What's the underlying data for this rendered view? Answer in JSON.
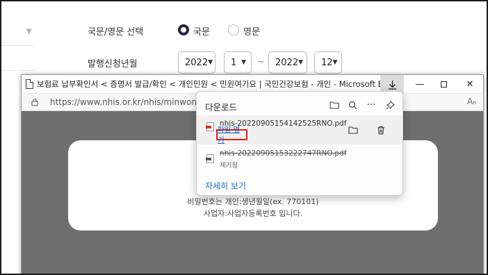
{
  "background": {
    "language_label": "국문/영문 선택",
    "radio_options": [
      {
        "label": "국문",
        "selected": true
      },
      {
        "label": "영문",
        "selected": false
      }
    ],
    "date_label": "발행신청년월",
    "from_year": "2022",
    "from_month": "1",
    "separator": "~",
    "to_year": "2022",
    "to_month": "12"
  },
  "window": {
    "title": "보험료 납부확인서 < 증명서 발급/확인 < 개인민원 < 민원여기요 | 국민건강보험 - 개인 - Microsoft Edge",
    "url": "https://www.nhis.or.kr/nhis/minwon/jpAe",
    "read_aloud": "Aₙ"
  },
  "page_card": {
    "line1": "비밀번호는 개인:생년월일(ex. 770101)",
    "line2": "사업자:사업자등록번호 입니다."
  },
  "downloads": {
    "title": "다운로드",
    "items": [
      {
        "filename": "nhis-20220905154142525RNO.pdf",
        "action": "파일 열기",
        "status": "active"
      },
      {
        "filename": "nhis-20220905153222747RNO.pdf",
        "action": "제거됨",
        "status": "removed"
      }
    ],
    "see_more": "자세히 보기"
  },
  "colors": {
    "accent": "#1a6bd6",
    "highlight_box": "#e02020",
    "overlay": "#6e6e6e"
  }
}
